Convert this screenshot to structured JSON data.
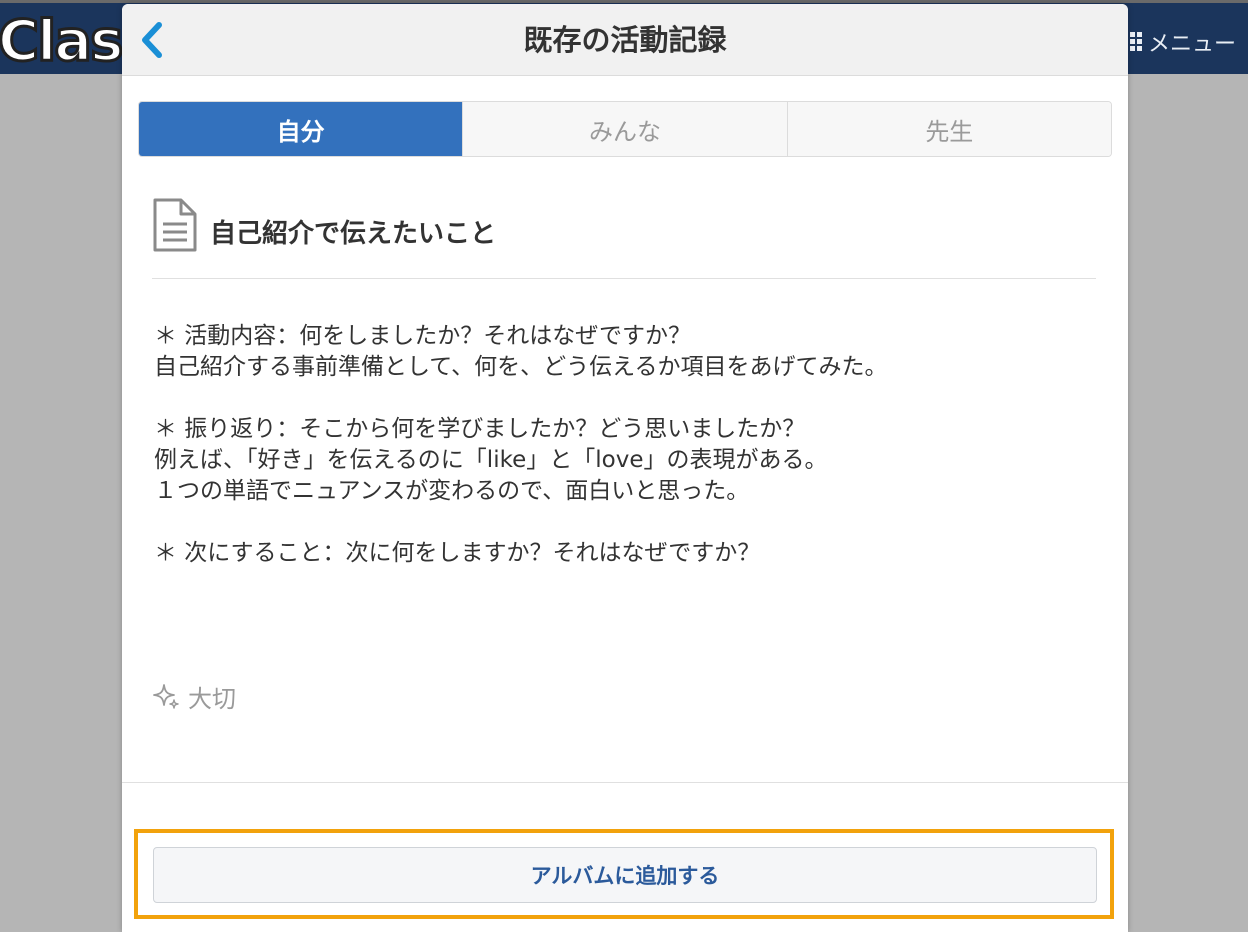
{
  "background": {
    "logo_text": "Class",
    "menu_label": "メニュー"
  },
  "modal": {
    "title": "既存の活動記録",
    "tabs": [
      {
        "label": "自分",
        "active": true
      },
      {
        "label": "みんな",
        "active": false
      },
      {
        "label": "先生",
        "active": false
      }
    ],
    "record": {
      "title": "自己紹介で伝えたいこと",
      "lines": [
        "＊ 活動内容：何をしましたか？それはなぜですか？",
        "自己紹介する事前準備として、何を、どう伝えるか項目をあげてみた。",
        "",
        "＊ 振り返り：そこから何を学びましたか？どう思いましたか？",
        "例えば、「好き」を伝えるのに「like」と「love」の表現がある。",
        "１つの単語でニュアンスが変わるので、面白いと思った。",
        "",
        "＊ 次にすること：次に何をしますか？それはなぜですか？"
      ]
    },
    "important_label": "大切",
    "album_button_label": "アルバムに追加する"
  },
  "colors": {
    "header_bg": "#1b355c",
    "tab_active": "#3371bd",
    "highlight": "#f2a20c",
    "back_chevron": "#1a8fd6",
    "button_text": "#2b5a9b"
  },
  "icons": {
    "back": "chevron-left-icon",
    "menu": "grid-icon",
    "record": "document-icon",
    "important": "sparkle-icon"
  }
}
